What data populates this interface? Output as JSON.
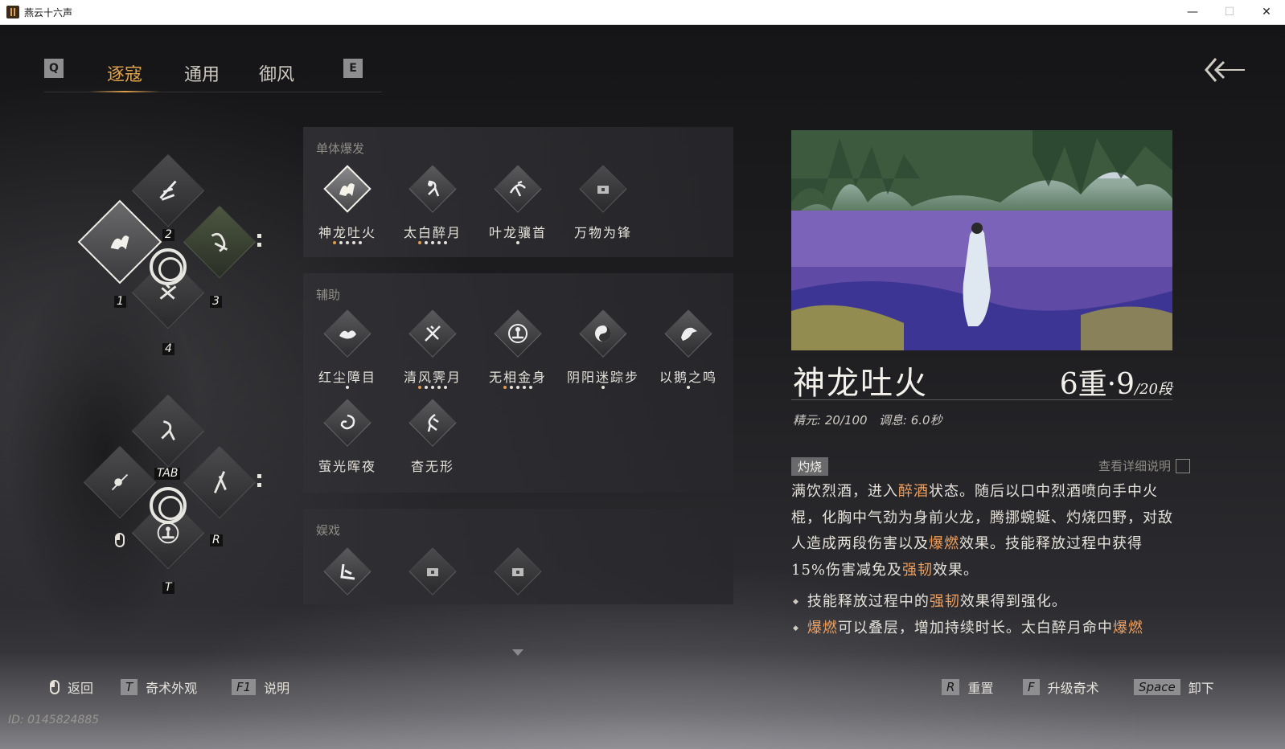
{
  "window": {
    "title": "燕云十六声"
  },
  "tabs": {
    "left_key": "Q",
    "right_key": "E",
    "items": [
      "逐寇",
      "通用",
      "御风"
    ],
    "active": 0
  },
  "wheel1": {
    "labels": [
      "1",
      "2",
      "3",
      "4"
    ]
  },
  "wheel2": {
    "labels": [
      "TAB",
      "R",
      "T"
    ]
  },
  "sections": {
    "burst": {
      "title": "单体爆发",
      "skills": [
        {
          "name": "神龙吐火",
          "dots": 5,
          "orange": 1,
          "selected": true,
          "icon": "dragon-fire-icon"
        },
        {
          "name": "太白醉月",
          "dots": 5,
          "orange": 1,
          "icon": "drunken-moon-icon"
        },
        {
          "name": "叶龙骧首",
          "dots": 1,
          "orange": 0,
          "icon": "leaf-dragon-icon"
        },
        {
          "name": "万物为锋",
          "dots": 0,
          "orange": 0,
          "icon": "locked-icon"
        }
      ]
    },
    "support": {
      "title": "辅助",
      "skills": [
        {
          "name": "红尘障目",
          "dots": 1,
          "orange": 0,
          "icon": "dust-blind-icon"
        },
        {
          "name": "清风霁月",
          "dots": 5,
          "orange": 1,
          "icon": "wind-moon-icon"
        },
        {
          "name": "无相金身",
          "dots": 5,
          "orange": 1,
          "icon": "golden-body-icon"
        },
        {
          "name": "阴阳迷踪步",
          "dots": 1,
          "orange": 0,
          "icon": "yin-yang-icon"
        },
        {
          "name": "以鹅之鸣",
          "dots": 1,
          "orange": 0,
          "icon": "goose-cry-icon"
        },
        {
          "name": "萤光晖夜",
          "dots": 0,
          "orange": 0,
          "icon": "firefly-icon"
        },
        {
          "name": "杳无形",
          "dots": 0,
          "orange": 0,
          "icon": "formless-icon"
        }
      ]
    },
    "fun": {
      "title": "娱戏"
    }
  },
  "detail": {
    "title": "神龙吐火",
    "level_main": "6重·9",
    "level_sub": "/20段",
    "stat_label1": "精元: 20/100",
    "stat_label2": "调息: 6.0秒",
    "tag": "灼烧",
    "more_link": "查看详细说明",
    "desc_parts": [
      "满饮烈酒，进入",
      "醉酒",
      "状态。随后以口中烈酒喷向手中火棍，化胸中气劲为身前火龙，腾挪蜿蜒、灼烧四野，对敌人造成两段伤害以及",
      "爆燃",
      "效果。技能释放过程中获得15%伤害减免及",
      "强韧",
      "效果。"
    ],
    "bullet1": [
      "技能释放过程中的",
      "强韧",
      "效果得到强化。"
    ],
    "bullet2": [
      "爆燃",
      "可以叠层，增加持续时长。太白醉月命中",
      "爆燃"
    ]
  },
  "bottom": {
    "back": "返回",
    "appearance_key": "T",
    "appearance": "奇术外观",
    "help_key": "F1",
    "help": "说明",
    "reset_key": "R",
    "reset": "重置",
    "upgrade_key": "F",
    "upgrade": "升级奇术",
    "unequip_key": "Space",
    "unequip": "卸下"
  },
  "uid": "ID: 0145824885",
  "colors": {
    "accent": "#e0a24a",
    "highlight": "#ef9f5e"
  }
}
